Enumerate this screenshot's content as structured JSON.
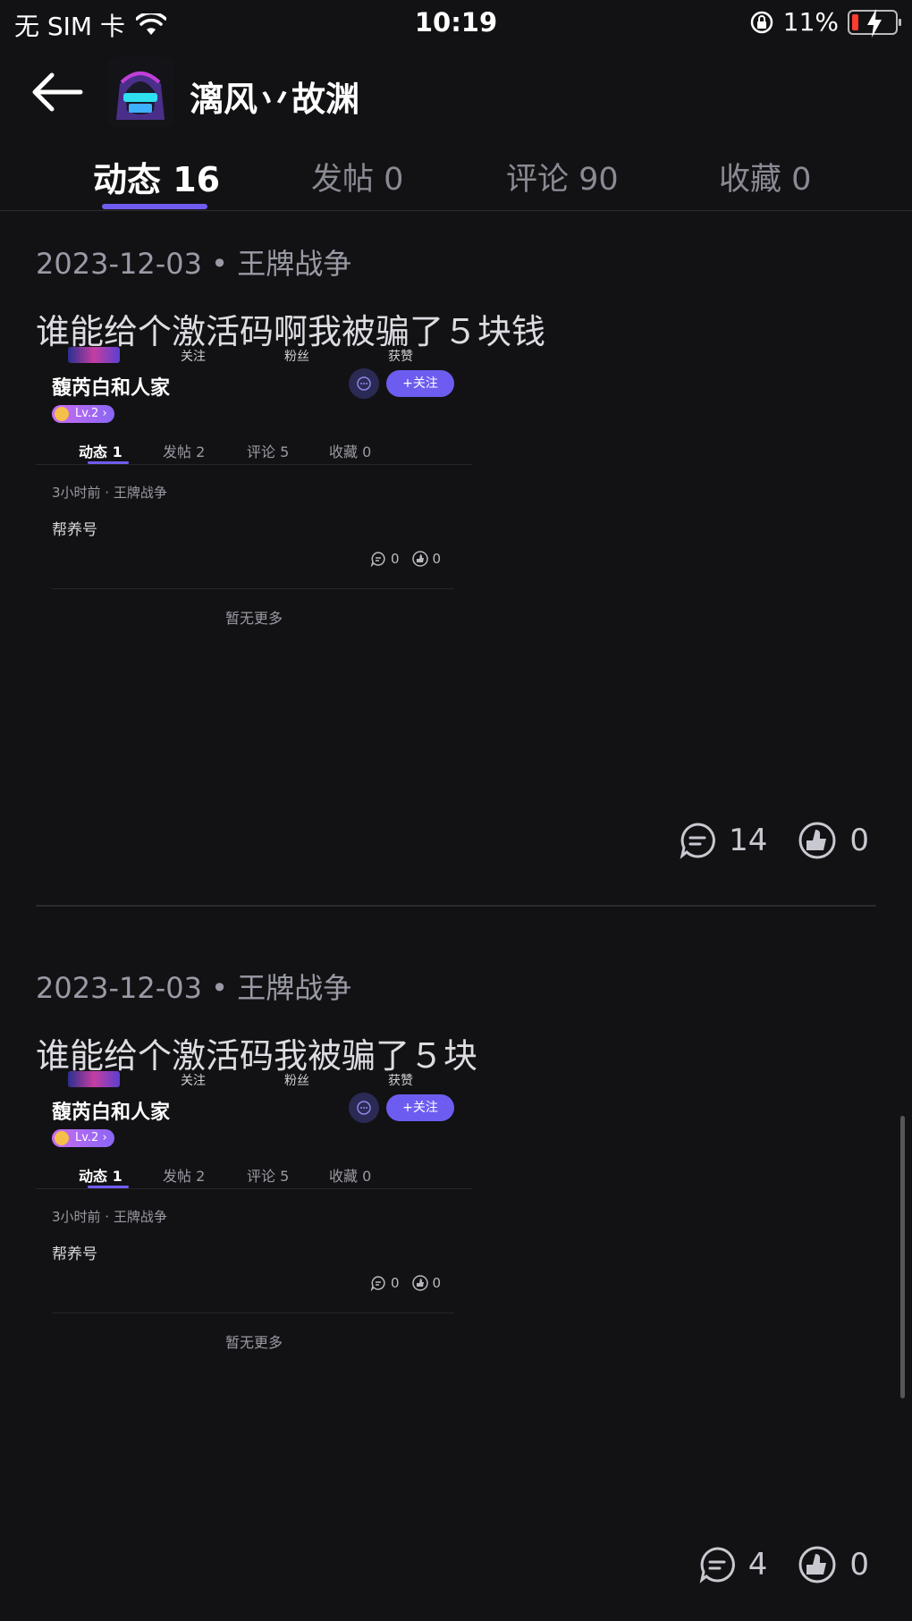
{
  "status_bar": {
    "carrier": "无 SIM 卡",
    "time": "10:19",
    "battery": "11%",
    "battery_color": "#ff3b30"
  },
  "header": {
    "back_icon": "back-arrow-icon",
    "username": "漓风丷故渊"
  },
  "tabs": [
    {
      "label": "动态 16",
      "active": true
    },
    {
      "label": "发帖 0",
      "active": false
    },
    {
      "label": "评论 90",
      "active": false
    },
    {
      "label": "收藏 0",
      "active": false
    }
  ],
  "accent_color": "#6f5cf0",
  "posts": [
    {
      "meta": "2023-12-03 • 王牌战争",
      "title": "谁能给个激活码啊我被骗了５块钱",
      "comments": "14",
      "likes": "0"
    },
    {
      "meta": "2023-12-03 • 王牌战争",
      "title": "谁能给个激活码我被骗了５块",
      "comments": "4",
      "likes": "0"
    }
  ],
  "embedded": {
    "stats": [
      "关注",
      "粉丝",
      "获赞"
    ],
    "name": "馥芮白和人家",
    "follow": "+关注",
    "level": "Lv.2",
    "tabs": [
      "动态 1",
      "发帖 2",
      "评论 5",
      "收藏 0"
    ],
    "meta": "3小时前 · 王牌战争",
    "body": "帮养号",
    "comments": "0",
    "likes": "0",
    "no_more": "暂无更多"
  }
}
